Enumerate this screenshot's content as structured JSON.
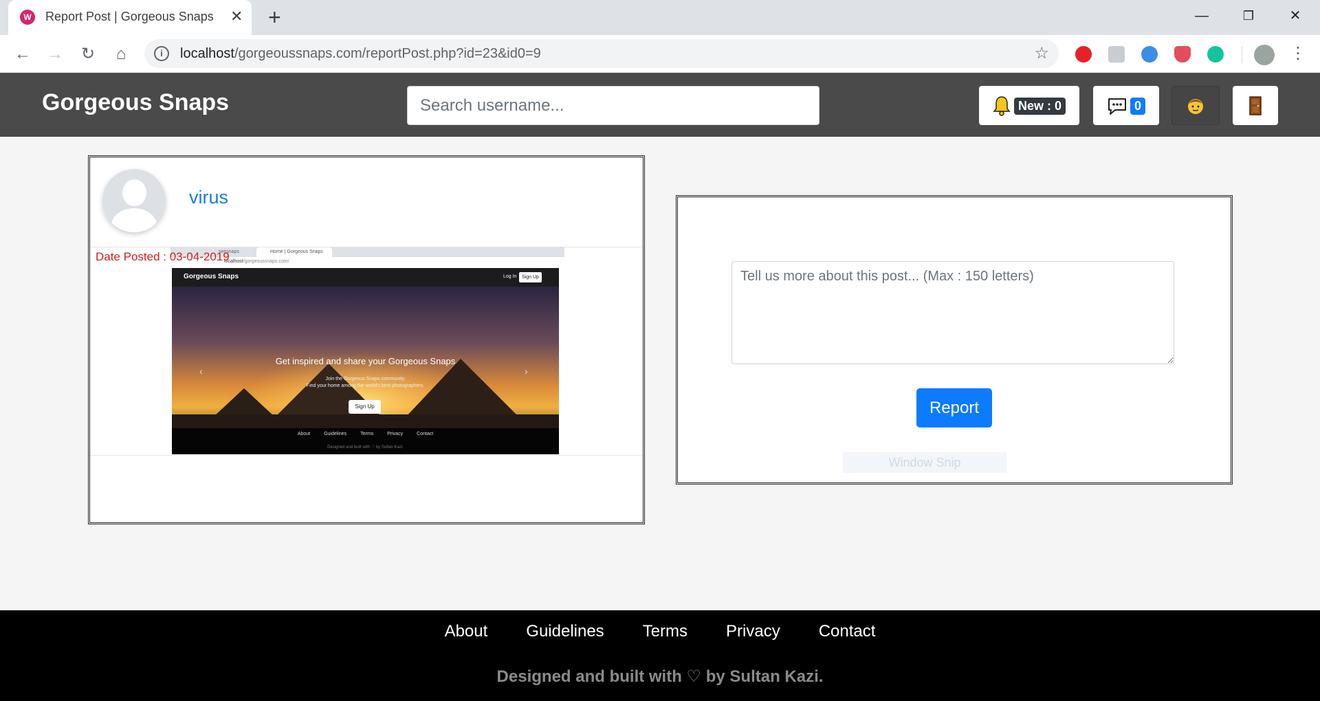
{
  "browser": {
    "tab_title": "Report Post | Gorgeous Snaps",
    "tab_favicon": "W",
    "url_host": "localhost",
    "url_path": "/gorgeoussnaps.com/reportPost.php?id=23&id0=9",
    "extensions": [
      "adblock-icon",
      "cube-extension-icon",
      "globe-extension-icon",
      "shield-extension-icon",
      "grammarly-icon"
    ],
    "ext_colors": [
      "#e8202a",
      "#c9ccd1",
      "#3a8ee6",
      "#e54d5f",
      "#15c39a"
    ]
  },
  "navbar": {
    "brand": "Gorgeous Snaps",
    "search_placeholder": "Search username...",
    "notifications_badge": "New : 0",
    "messages_badge": "0",
    "accent_color": "#0d7bff"
  },
  "post": {
    "username": "virus",
    "date_posted": "Date Posted : 03-04-2019",
    "image": {
      "tab_title": "Home | Gorgeous Snaps",
      "prev_tab": "seesnaps",
      "url_host": "localhost",
      "url_path": "/gorgeoussnaps.com/",
      "brand": "Gorgeous Snaps",
      "login": "Log In",
      "signup": "Sign Up",
      "hero_title": "Get inspired and share your Gorgeous Snaps",
      "hero_sub1": "Join the Gorgeous Snaps community.",
      "hero_sub2": "Find your home among the world's best photographers.",
      "hero_button": "Sign Up",
      "footer_links": [
        "About",
        "Guidelines",
        "Terms",
        "Privacy",
        "Contact"
      ],
      "footer_credit": "Designed and built with ♡ by Sultan Kazi."
    }
  },
  "report": {
    "placeholder": "Tell us more about this post... (Max : 150 letters)",
    "button": "Report",
    "overlay_text": "Window Snip"
  },
  "footer": {
    "links": [
      "About",
      "Guidelines",
      "Terms",
      "Privacy",
      "Contact"
    ],
    "credit": "Designed and built with ♡ by Sultan Kazi."
  }
}
